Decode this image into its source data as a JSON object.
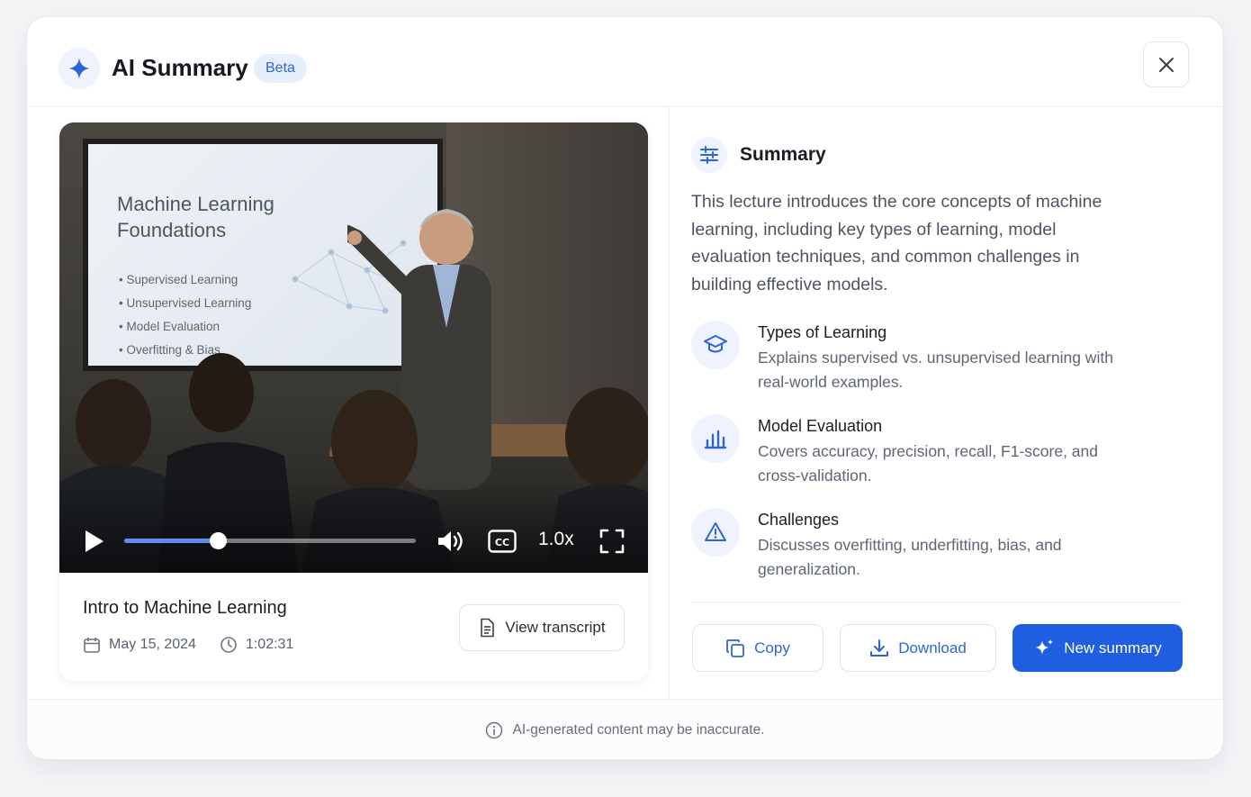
{
  "header": {
    "title": "AI Summary",
    "badge": "Beta",
    "close_icon": "close-icon",
    "logo_icon": "sparkle-icon"
  },
  "video": {
    "slide_title": "Machine Learning Foundations",
    "slide_bullets": [
      "Supervised Learning",
      "Unsupervised Learning",
      "Model Evaluation",
      "Overfitting & Bias"
    ],
    "progress_fraction": 0.32,
    "speed": "1.0x",
    "title": "Intro to Machine Learning",
    "date": "May 15, 2024",
    "duration": "1:02:31",
    "transcript_label": "View transcript"
  },
  "summary": {
    "heading": "Summary",
    "text": "This lecture introduces the core concepts of machine learning, including key types of learning, model evaluation techniques, and common challenges in building effective models.",
    "points": [
      {
        "title": "Types of Learning",
        "desc": "Explains supervised vs. unsupervised learning with real-world examples.",
        "icon": "graduation-cap-icon"
      },
      {
        "title": "Model Evaluation",
        "desc": "Covers accuracy, precision, recall, F1-score, and cross-validation.",
        "icon": "bar-chart-icon"
      },
      {
        "title": "Challenges",
        "desc": "Discusses overfitting, underfitting, bias, and generalization.",
        "icon": "warning-icon"
      }
    ]
  },
  "actions": {
    "copy": "Copy",
    "download": "Download",
    "new_summary": "New summary"
  },
  "footer": {
    "note": "AI-generated content may be inaccurate."
  },
  "colors": {
    "accent": "#1f5ee0",
    "accent_light": "#eef3fd"
  }
}
